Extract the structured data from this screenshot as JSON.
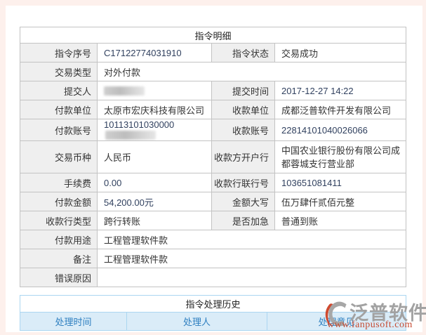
{
  "detail_table": {
    "title": "指令明细",
    "rows": {
      "r0": {
        "label": "指令序号",
        "value": "C17122774031910",
        "label2": "指令状态",
        "value2": "交易成功"
      },
      "r1": {
        "label": "交易类型",
        "value": "对外付款"
      },
      "r2": {
        "label": "提交人",
        "value": "",
        "label2": "提交时间",
        "value2": "2017-12-27 14:22"
      },
      "r3": {
        "label": "付款单位",
        "value": "太原市宏庆科技有限公司",
        "label2": "收款单位",
        "value2": "成都泛普软件开发有限公司"
      },
      "r4": {
        "label": "付款账号",
        "value": "10113101030000",
        "label2": "收款账号",
        "value2": "22814101040026066"
      },
      "r5": {
        "label": "交易币种",
        "value": "人民币",
        "label2": "收款方开户行",
        "value2": "中国农业银行股份有限公司成都蓉城支行营业部"
      },
      "r6": {
        "label": "手续费",
        "value": "0.00",
        "label2": "收款行联行号",
        "value2": "103651081411"
      },
      "r7": {
        "label": "付款金额",
        "value": "54,200.00元",
        "label2": "金额大写",
        "value2": "伍万肆仟贰佰元整"
      },
      "r8": {
        "label": "收款行类型",
        "value": "跨行转账",
        "label2": "是否加急",
        "value2": "普通到账"
      },
      "r9": {
        "label": "付款用途",
        "value": "工程管理软件款"
      },
      "r10": {
        "label": "备注",
        "value": "工程管理软件款"
      },
      "r11": {
        "label": "错误原因",
        "value": ""
      }
    }
  },
  "history_table": {
    "title": "指令处理历史",
    "columns": {
      "c0": "处理时间",
      "c1": "处理人",
      "c2": "处理意见"
    }
  },
  "watermark": {
    "brand": "泛普软件",
    "url": "www.fanpusoft.com"
  },
  "colors": {
    "frame_pink": "#fdf0ec",
    "detail_border": "#c3c3c3",
    "label_bg": "#efefef",
    "history_border": "#abd6f1",
    "history_header_bg": "#daecf8",
    "history_header_text": "#2e7fc0",
    "watermark_gray": "#a2a2a2",
    "watermark_red": "#c64a31"
  }
}
